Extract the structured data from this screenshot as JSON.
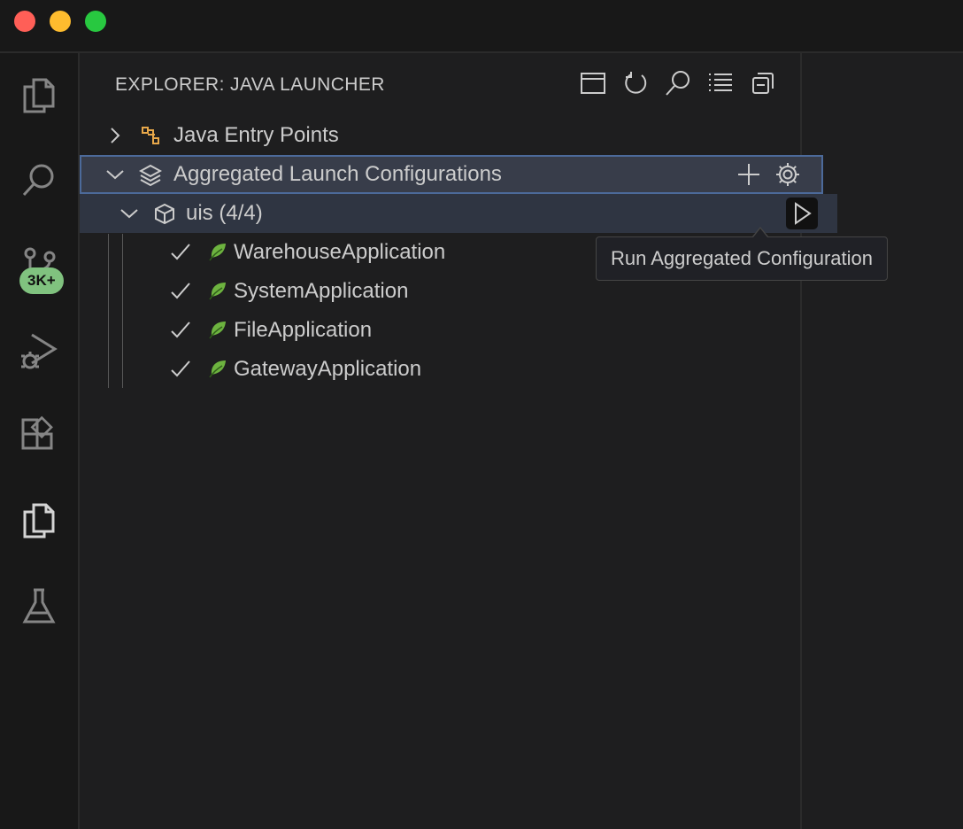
{
  "window": {
    "controls": [
      "close",
      "minimize",
      "zoom"
    ]
  },
  "activity_bar": {
    "items": [
      {
        "icon": "files-icon"
      },
      {
        "icon": "search-icon"
      },
      {
        "icon": "source-control-icon",
        "badge": "3K+"
      },
      {
        "icon": "run-debug-icon"
      },
      {
        "icon": "extensions-icon"
      },
      {
        "icon": "java-launcher-icon"
      },
      {
        "icon": "testing-icon"
      }
    ]
  },
  "sidebar": {
    "title": "EXPLORER: JAVA LAUNCHER",
    "actions": [
      "panel-icon",
      "refresh-icon",
      "search-icon",
      "list-view-icon",
      "collapse-all-icon"
    ]
  },
  "tree": {
    "entry_points": {
      "label": "Java Entry Points"
    },
    "aggregated": {
      "label": "Aggregated Launch Configurations"
    },
    "group": {
      "label": "uis (4/4)"
    },
    "apps": [
      {
        "label": "WarehouseApplication"
      },
      {
        "label": "SystemApplication"
      },
      {
        "label": "FileApplication"
      },
      {
        "label": "GatewayApplication"
      }
    ]
  },
  "tooltip": {
    "text": "Run Aggregated Configuration"
  },
  "colors": {
    "accent_orange": "#e8a84a",
    "spring_green": "#6db33f",
    "badge_green": "#80c27f"
  }
}
